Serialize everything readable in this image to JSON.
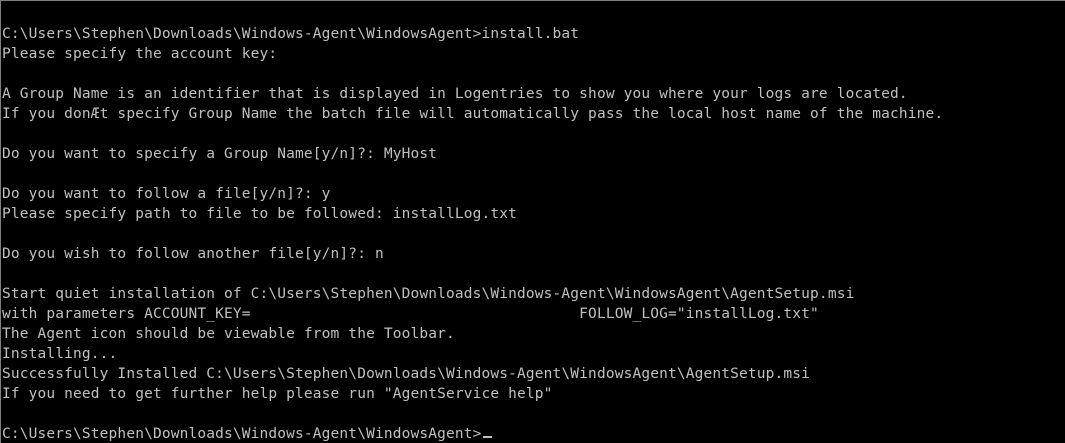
{
  "console": {
    "lines": [
      "C:\\Users\\Stephen\\Downloads\\Windows-Agent\\WindowsAgent>install.bat",
      "Please specify the account key:",
      "",
      "A Group Name is an identifier that is displayed in Logentries to show you where your logs are located.",
      "If you donÆt specify Group Name the batch file will automatically pass the local host name of the machine.",
      "",
      "Do you want to specify a Group Name[y/n]?: MyHost",
      "",
      "Do you want to follow a file[y/n]?: y",
      "Please specify path to file to be followed: installLog.txt",
      "",
      "Do you wish to follow another file[y/n]?: n",
      "",
      "Start quiet installation of C:\\Users\\Stephen\\Downloads\\Windows-Agent\\WindowsAgent\\AgentSetup.msi",
      "with parameters ACCOUNT_KEY=                                     FOLLOW_LOG=\"installLog.txt\"",
      "The Agent icon should be viewable from the Toolbar.",
      "Installing...",
      "Successfully Installed C:\\Users\\Stephen\\Downloads\\Windows-Agent\\WindowsAgent\\AgentSetup.msi",
      "If you need to get further help please run \"AgentService help\"",
      "",
      "C:\\Users\\Stephen\\Downloads\\Windows-Agent\\WindowsAgent>"
    ]
  },
  "colors": {
    "background": "#000000",
    "text": "#c0c0c0"
  }
}
